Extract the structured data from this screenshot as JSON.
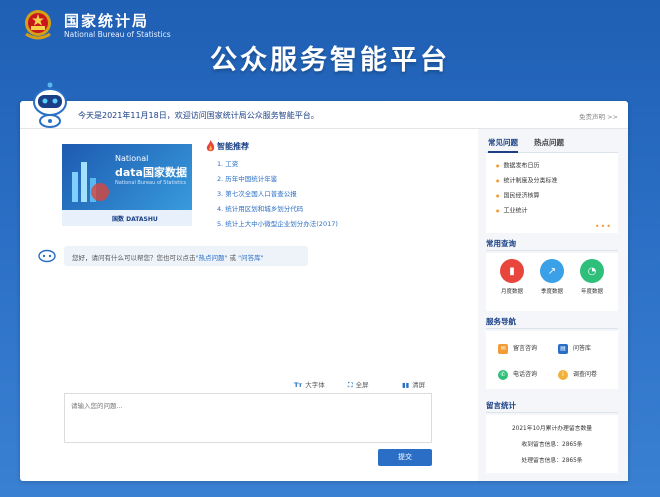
{
  "header": {
    "org_cn": "国家统计局",
    "org_en": "National Bureau of Statistics",
    "platform_title": "公众服务智能平台"
  },
  "welcome": {
    "text": "今天是2021年11月18日，欢迎访问国家统计局公众服务智能平台。",
    "disclaimer": "免责声明 >>"
  },
  "banner": {
    "line1": "National",
    "line2": "data国家数据",
    "line3": "National Bureau of Statistics",
    "brand": "国数 DATASHU"
  },
  "recommend": {
    "title": "智能推荐",
    "items": [
      "1. 工资",
      "2. 历年中国统计年鉴",
      "3. 第七次全国人口普查公报",
      "4. 统计用区划和城乡划分代码",
      "5. 统计上大中小微型企业划分办法(2017)"
    ]
  },
  "bot_message": {
    "prefix": "您好，请问有什么可以帮您？您也可以点击",
    "link1": "\"热点问题\"",
    "middle": " 或 ",
    "link2": "\"问答库\""
  },
  "tools": {
    "font": "大字体",
    "fullscreen": "全屏",
    "clear": "清屏"
  },
  "input": {
    "placeholder": "请输入您的问题..."
  },
  "submit_label": "提交",
  "sidebar": {
    "tabs": [
      "常见问题",
      "热点问题"
    ],
    "faq": [
      "数据发布日历",
      "统计制度及分类标准",
      "国民经济核算",
      "工业统计"
    ],
    "more": "•••",
    "query_title": "常用查询",
    "queries": [
      {
        "label": "月度数据",
        "color": "#e8463c",
        "icon": "bar-chart"
      },
      {
        "label": "季度数据",
        "color": "#3aa0e8",
        "icon": "line-chart"
      },
      {
        "label": "年度数据",
        "color": "#2ebf7a",
        "icon": "pie-chart"
      }
    ],
    "nav_title": "服务导航",
    "nav": [
      {
        "label": "留言咨询",
        "color": "#f29c38",
        "icon": "mail"
      },
      {
        "label": "问答库",
        "color": "#2a6fc5",
        "icon": "book"
      },
      {
        "label": "电话咨询",
        "color": "#2ebf7a",
        "icon": "phone"
      },
      {
        "label": "调查问卷",
        "color": "#f2b138",
        "icon": "info"
      }
    ],
    "stats_title": "留言统计",
    "stats": [
      "2021年10月累计办理留言数量",
      "收到留言信息：2865条",
      "处理留言信息：2865条"
    ]
  }
}
